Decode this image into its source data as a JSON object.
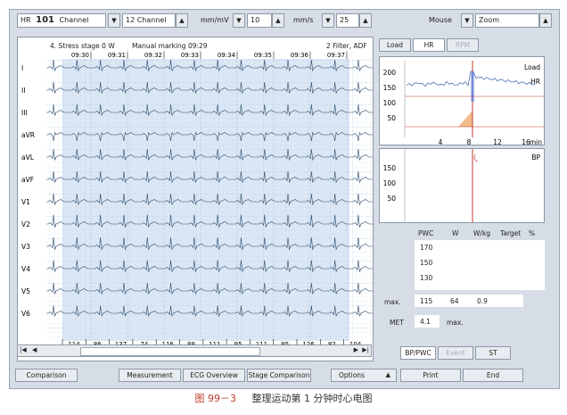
{
  "toolbar": {
    "hr_label": "HR",
    "hr_value": "101",
    "channel_label": "Channel",
    "channel_select": "12 Channel",
    "sens_unit": "mm/mV",
    "sens_value": "10",
    "speed_unit": "mm/s",
    "speed_value": "25",
    "mouse_label": "Mouse",
    "mouse_mode": "Zoom"
  },
  "ecg": {
    "stage": "4. Stress stage  0 W",
    "marking": "Manual marking 09:29",
    "filter": "2 Filter, ADF",
    "times": [
      "09:30",
      "09:31",
      "09:32",
      "09:33",
      "09:34",
      "09:35",
      "09:36",
      "09:37"
    ],
    "leads": [
      "I",
      "II",
      "III",
      "aVR",
      "aVL",
      "aVF",
      "V1",
      "V2",
      "V3",
      "V4",
      "V5",
      "V6"
    ],
    "rr": [
      "114",
      "86",
      "137",
      "74",
      "116",
      "89",
      "111",
      "95",
      "111",
      "95",
      "126",
      "82",
      "104"
    ]
  },
  "side_tabs": [
    "Load",
    "HR",
    "RPM"
  ],
  "trend_chart": {
    "labels": [
      "Load",
      "HR"
    ],
    "yticks": [
      "200",
      "150",
      "100",
      "50"
    ],
    "xticks": [
      "4",
      "8",
      "12",
      "16"
    ],
    "xunit": "min"
  },
  "bp_chart": {
    "label": "BP",
    "yticks": [
      "150",
      "100",
      "50"
    ]
  },
  "table": {
    "headers": [
      "PWC",
      "W",
      "W/kg",
      "Target",
      "%"
    ],
    "pwc_values": [
      "170",
      "150",
      "130"
    ],
    "max_label": "max.",
    "max_values": [
      "115",
      "64",
      "0.9"
    ],
    "met_label": "MET",
    "met_value": "4.1",
    "met_suffix": "max."
  },
  "bottom_tabs": [
    "BP/PWC",
    "Event",
    "ST"
  ],
  "footer_buttons": [
    "Comparison",
    "Measurement",
    "ECG Overview",
    "Stage Comparison",
    "Options",
    "Print",
    "End"
  ],
  "caption": {
    "number": "图 99－3",
    "text": "整理运动第 1 分钟时心电图"
  },
  "colors": {
    "grid": "#c4dce8",
    "trace": "#2a4a6a",
    "highlight": "#bfd3ec",
    "marker": "#c0392b",
    "load_fill": "#f0ab6e"
  }
}
